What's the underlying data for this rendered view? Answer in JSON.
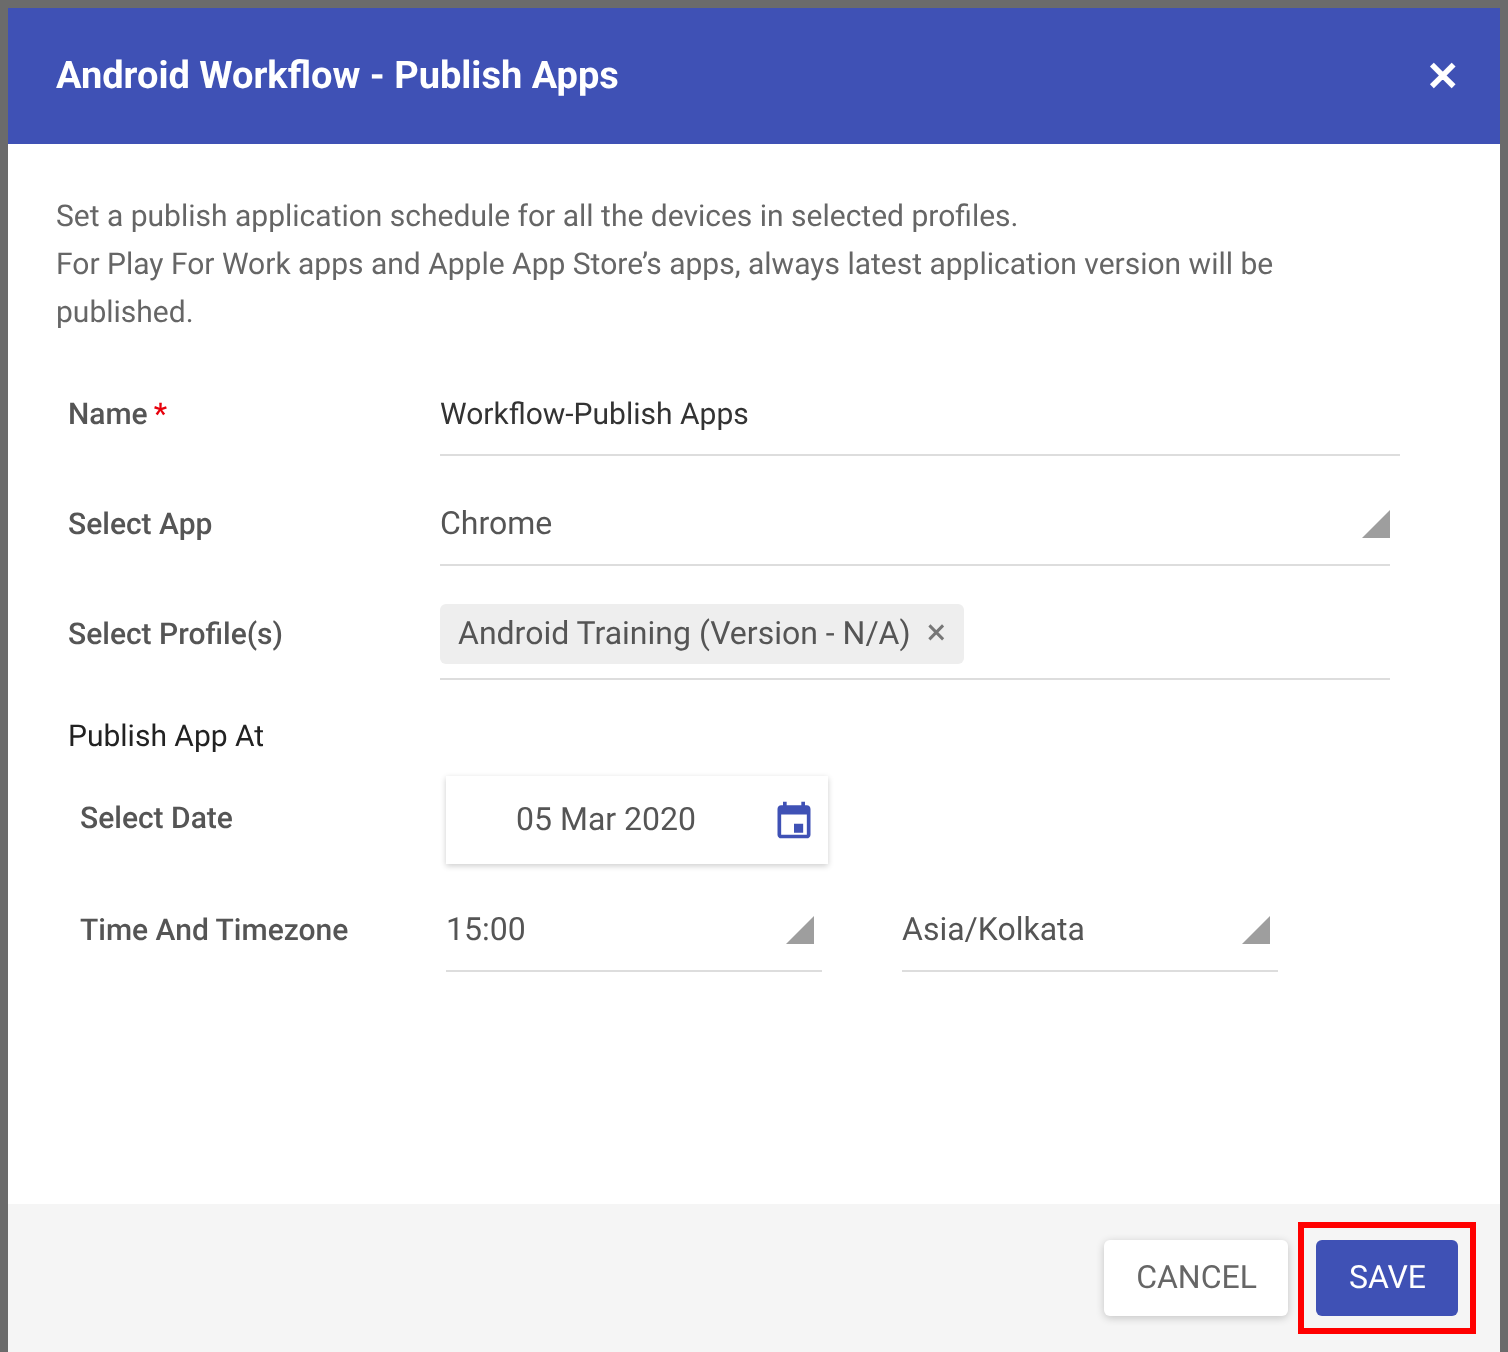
{
  "dialog": {
    "title": "Android Workflow - Publish Apps",
    "close": "✕"
  },
  "description": [
    "Set a publish application schedule for all the devices in selected profiles.",
    "For Play For Work apps and Apple App Store’s apps, always latest application version will be published."
  ],
  "fields": [
    {
      "kind": "text",
      "label": "Name",
      "required_mark": "*",
      "value": "Workflow-Publish Apps"
    },
    {
      "kind": "select",
      "label": "Select App",
      "value": "Chrome"
    },
    {
      "kind": "chips",
      "label": "Select Profile(s)",
      "chips": [
        {
          "label": "Android Training (Version - N/A)",
          "remove": "×"
        }
      ]
    }
  ],
  "publish": {
    "heading": "Publish App At",
    "date_label": "Select Date",
    "date": "05 Mar 2020",
    "time_label": "Time And Timezone",
    "time": "15:00",
    "timezone": "Asia/Kolkata"
  },
  "buttons": [
    {
      "label": "CANCEL",
      "kind": "secondary",
      "highlighted": false
    },
    {
      "label": "SAVE",
      "kind": "primary",
      "highlighted": true
    }
  ]
}
